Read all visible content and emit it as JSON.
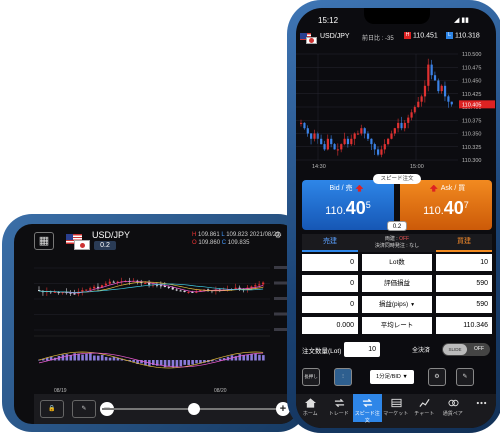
{
  "landscape": {
    "pair": "USD/JPY",
    "spread": "0.2",
    "high_value": "109.861",
    "low_value": "109.823",
    "open_value": "109.860",
    "close_value": "109.835",
    "date": "2021/08/23",
    "x_labels": [
      "08/19",
      "08/20"
    ]
  },
  "portrait": {
    "status_time": "15:12",
    "pair": "USD/JPY",
    "prev_day": "前日比 : -35",
    "high": "110.451",
    "low": "110.318",
    "y_ticks": [
      "110.500",
      "110.475",
      "110.450",
      "110.425",
      "110.400",
      "110.375",
      "110.350",
      "110.325",
      "110.300"
    ],
    "current_price": "110.405",
    "x_times": [
      "14:30",
      "15:00"
    ],
    "speed_order": "スピード注文",
    "bid_label": "Bid / 売",
    "ask_label": "Ask / 買",
    "bid_small": "110.",
    "bid_big": "40",
    "bid_sup": "5",
    "ask_small": "110.",
    "ask_big": "40",
    "ask_sup": "7",
    "spread": "0.2",
    "table": {
      "sell": "売建",
      "buy": "買建",
      "mid_line1": "両建 : ",
      "mid_off": "OFF",
      "mid_line2": "決済同時発注 : なし",
      "rows": [
        {
          "left": "0",
          "label": "Lot数",
          "right": "10"
        },
        {
          "left": "0",
          "label": "評価損益",
          "right": "590"
        },
        {
          "left": "0",
          "label": "損益(pips)",
          "right": "590"
        },
        {
          "left": "0.000",
          "label": "平均レート",
          "right": "110.346"
        }
      ],
      "dropdown_caret": "▼"
    },
    "qty_label": "注文数量(Lot)",
    "qty_value": "10",
    "settle_label": "全決済",
    "slide_label": "SLIDE",
    "off_label": "OFF",
    "expand_label": "長押し",
    "timeframe": "1分足/BID ▼",
    "tabs": [
      "ホーム",
      "トレード",
      "スピード注文",
      "マーケット",
      "チャート",
      "通貨ペア"
    ]
  },
  "colors": {
    "bull": "#e03131",
    "bear": "#3b82e6",
    "bid": "#2e86e8",
    "ask": "#f28a20"
  }
}
